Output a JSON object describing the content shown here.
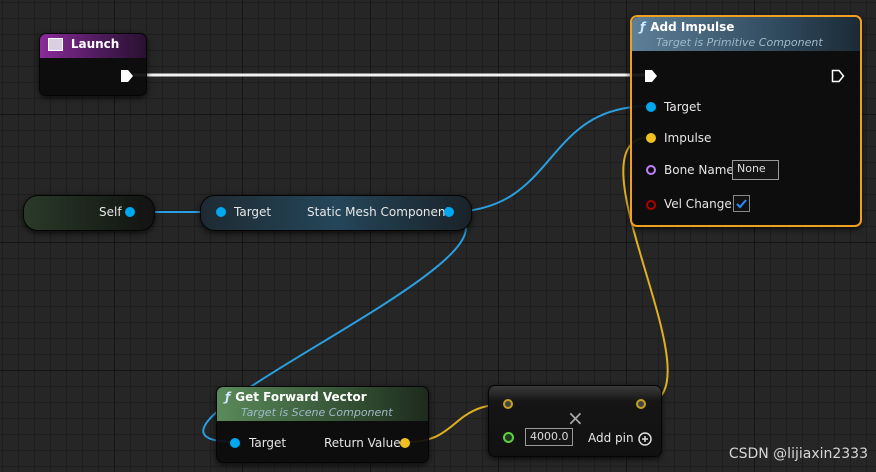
{
  "launch_node": {
    "title": "Launch"
  },
  "add_impulse_node": {
    "title": "Add Impulse",
    "subtitle": "Target is Primitive Component",
    "pins": {
      "target": "Target",
      "impulse": "Impulse",
      "bone_name": "Bone Name",
      "vel_change": "Vel Change"
    },
    "bone_name_value": "None",
    "vel_change_checked": true
  },
  "self_node": {
    "label": "Self"
  },
  "static_mesh_node": {
    "target": "Target",
    "output": "Static Mesh Component"
  },
  "forward_vector_node": {
    "title": "Get Forward Vector",
    "subtitle": "Target is Scene Component",
    "target": "Target",
    "output": "Return Value"
  },
  "multiply_node": {
    "value": "4000.0",
    "add_pin": "Add pin",
    "op_symbol": "×"
  },
  "icons": [
    "function-icon",
    "event-icon",
    "exec-pin-icon",
    "add-pin-icon",
    "checkbox-icon"
  ],
  "colors": {
    "exec": "#ffffff",
    "object": "#00a8f0",
    "vector": "#f0c020",
    "name": "#c080ff",
    "bool": "#a00000",
    "float": "#60d040",
    "selection": "#f0a020"
  },
  "watermark": "CSDN @lijiaxin2333"
}
